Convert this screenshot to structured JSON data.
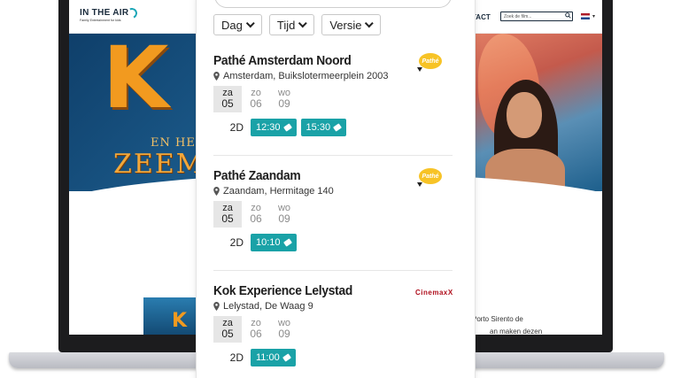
{
  "site": {
    "logo_text": "IN THE AIR",
    "logo_tagline": "Family Entertainment for kids",
    "nav_contact": "TACT",
    "search_placeholder": "Zoek de film...",
    "hero_letter": "K",
    "hero_line1": "EN HET LI",
    "hero_line2": "ZEEME",
    "promo_letter": "K",
    "body_text_1": "Porto Sirento de",
    "body_text_2": "an maken dezen"
  },
  "filters": [
    {
      "label": "Dag"
    },
    {
      "label": "Tijd"
    },
    {
      "label": "Versie"
    }
  ],
  "cinemas": [
    {
      "name": "Pathé Amsterdam Noord",
      "address": "Amsterdam, Buikslotermeerplein 2003",
      "logo": "pathe-logo",
      "logo_text": "Pathé",
      "days": [
        {
          "dow": "za",
          "num": "05",
          "active": true
        },
        {
          "dow": "zo",
          "num": "06",
          "active": false
        },
        {
          "dow": "wo",
          "num": "09",
          "active": false
        }
      ],
      "format": "2D",
      "times": [
        "12:30",
        "15:30"
      ]
    },
    {
      "name": "Pathé Zaandam",
      "address": "Zaandam, Hermitage 140",
      "logo": "pathe-logo",
      "logo_text": "Pathé",
      "days": [
        {
          "dow": "za",
          "num": "05",
          "active": true
        },
        {
          "dow": "zo",
          "num": "06",
          "active": false
        },
        {
          "dow": "wo",
          "num": "09",
          "active": false
        }
      ],
      "format": "2D",
      "times": [
        "10:10"
      ]
    },
    {
      "name": "Kok Experience Lelystad",
      "address": "Lelystad, De Waag 9",
      "logo": "cinemaxx-logo",
      "logo_text": "CinemaxX",
      "days": [
        {
          "dow": "za",
          "num": "05",
          "active": true
        },
        {
          "dow": "zo",
          "num": "06",
          "active": false
        },
        {
          "dow": "wo",
          "num": "09",
          "active": false
        }
      ],
      "format": "2D",
      "times": [
        "11:00"
      ]
    }
  ],
  "colors": {
    "accent": "#1aa2a7",
    "pathe_yellow": "#f7c326",
    "cinemaxx_red": "#b0101e"
  }
}
